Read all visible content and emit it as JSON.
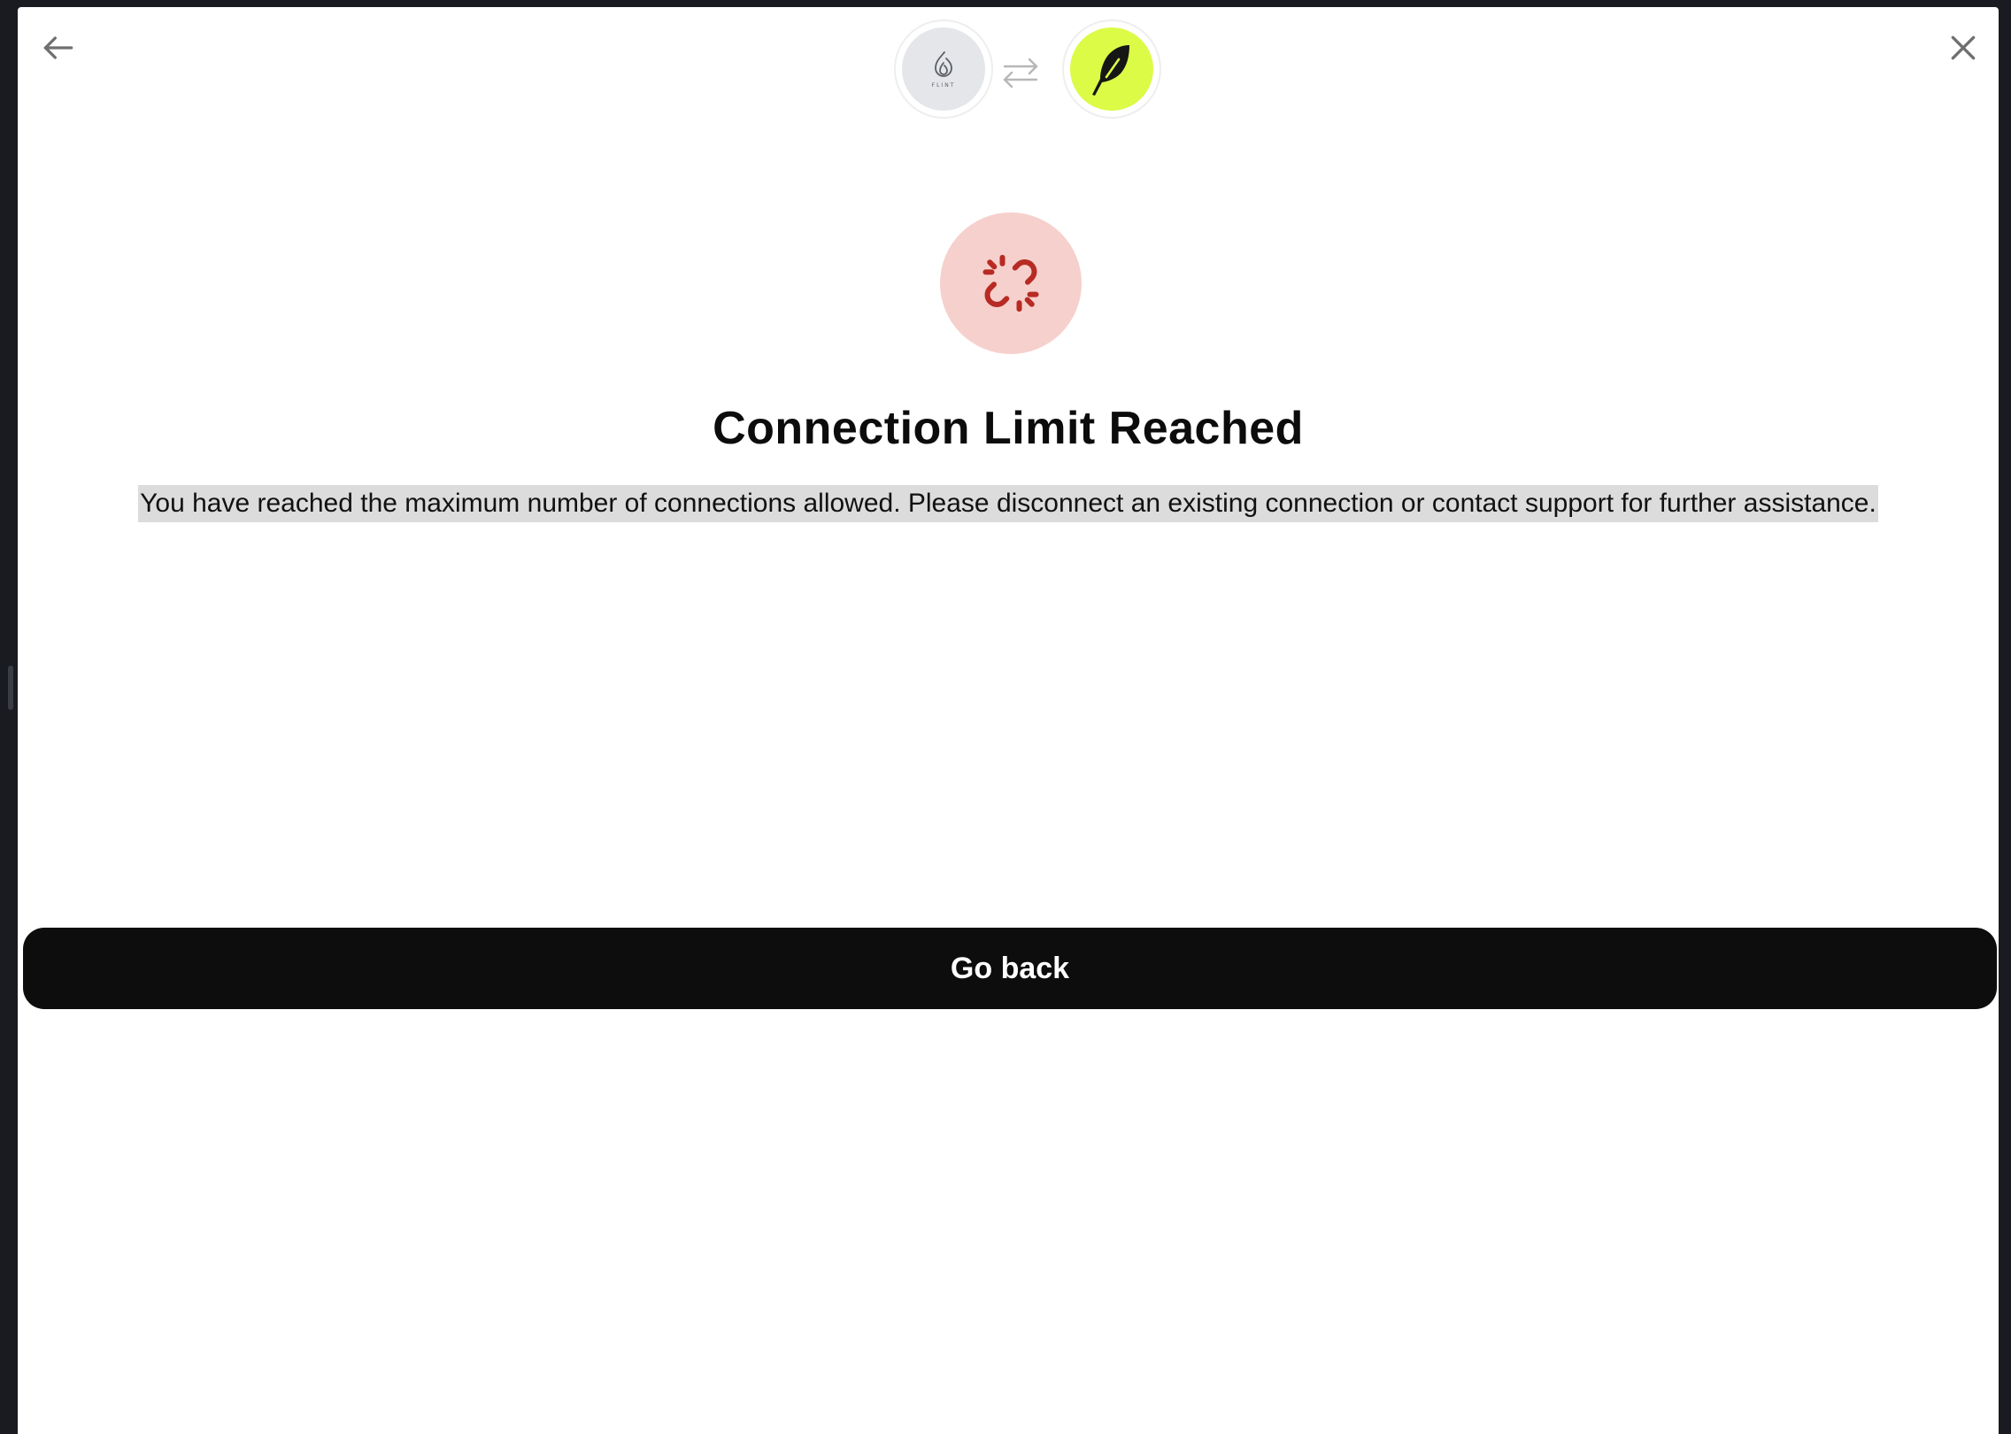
{
  "header": {
    "back_icon": "arrow-left-icon",
    "close_icon": "close-icon",
    "swap_icon": "swap-arrows-icon",
    "left_logo": {
      "icon": "flint-flame-logo",
      "wordmark": "FLINT",
      "bg": "#e4e6e9"
    },
    "right_logo": {
      "icon": "robinhood-feather-logo",
      "bg": "#dbfb46"
    }
  },
  "status": {
    "icon": "broken-link-icon",
    "circle_color": "#f6d0cc",
    "icon_color": "#b72b24"
  },
  "content": {
    "title": "Connection Limit Reached",
    "message": "You have reached the maximum number of connections allowed. Please disconnect an existing connection or contact support for further assistance."
  },
  "actions": {
    "go_back_label": "Go back"
  }
}
